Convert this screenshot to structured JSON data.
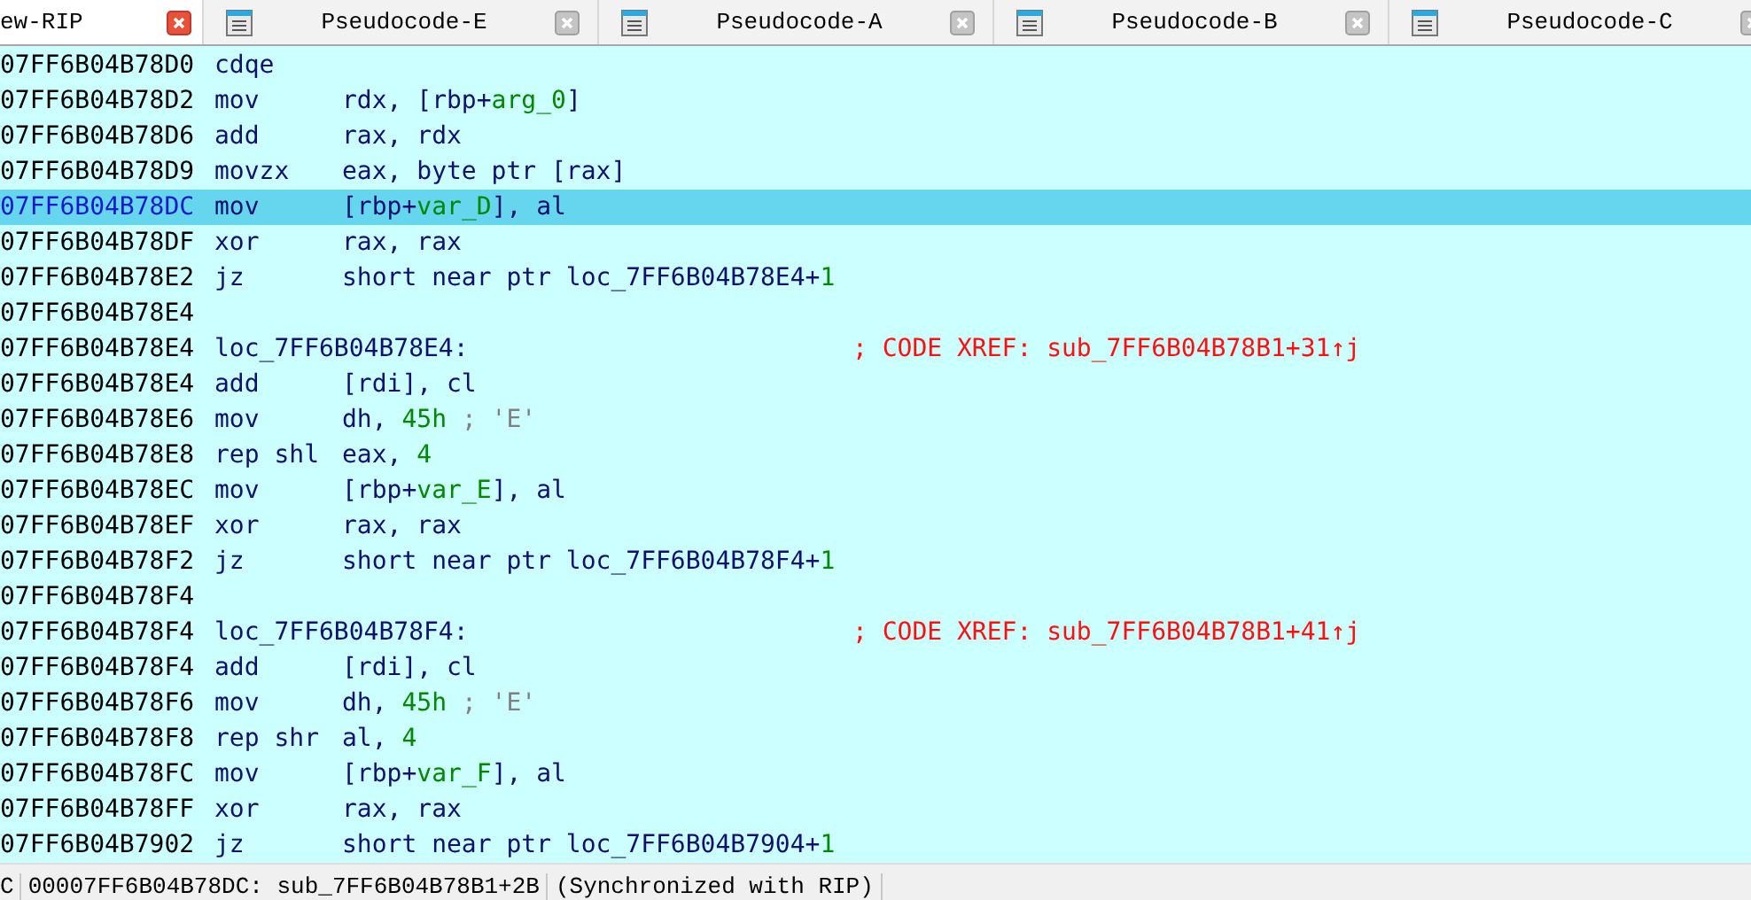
{
  "tabs": [
    {
      "label": "ew-RIP",
      "selected": true
    },
    {
      "label": "Pseudocode-E",
      "selected": false
    },
    {
      "label": "Pseudocode-A",
      "selected": false
    },
    {
      "label": "Pseudocode-B",
      "selected": false
    },
    {
      "label": "Pseudocode-C",
      "selected": false
    }
  ],
  "lines": [
    {
      "kind": "insn",
      "address": "07FF6B04B78D0",
      "mnemonic": "cdqe",
      "selected": false
    },
    {
      "kind": "insn",
      "address": "07FF6B04B78D2",
      "mnemonic": "mov",
      "operands": [
        {
          "text": "rdx, [rbp+",
          "kind": "plain"
        },
        {
          "text": "arg_0",
          "kind": "name"
        },
        {
          "text": "]",
          "kind": "plain"
        }
      ],
      "selected": false
    },
    {
      "kind": "insn",
      "address": "07FF6B04B78D6",
      "mnemonic": "add",
      "operands": [
        {
          "text": "rax, rdx",
          "kind": "plain"
        }
      ],
      "selected": false
    },
    {
      "kind": "insn",
      "address": "07FF6B04B78D9",
      "mnemonic": "movzx",
      "operands": [
        {
          "text": "eax, byte ptr [rax]",
          "kind": "plain"
        }
      ],
      "selected": false
    },
    {
      "kind": "insn",
      "address": "07FF6B04B78DC",
      "mnemonic": "mov",
      "operands": [
        {
          "text": "[rbp+",
          "kind": "plain"
        },
        {
          "text": "var_D",
          "kind": "name"
        },
        {
          "text": "], al",
          "kind": "plain"
        }
      ],
      "selected": true
    },
    {
      "kind": "insn",
      "address": "07FF6B04B78DF",
      "mnemonic": "xor",
      "operands": [
        {
          "text": "rax, rax",
          "kind": "plain"
        }
      ],
      "selected": false
    },
    {
      "kind": "insn",
      "address": "07FF6B04B78E2",
      "mnemonic": "jz",
      "operands": [
        {
          "text": "short near ptr loc_7FF6B04B78E4+",
          "kind": "plain"
        },
        {
          "text": "1",
          "kind": "num"
        }
      ],
      "selected": false
    },
    {
      "kind": "blank",
      "address": "07FF6B04B78E4",
      "selected": false
    },
    {
      "kind": "label",
      "address": "07FF6B04B78E4",
      "label": "loc_7FF6B04B78E4:",
      "xref": "; CODE XREF: sub_7FF6B04B78B1+31↑j",
      "selected": false
    },
    {
      "kind": "insn",
      "address": "07FF6B04B78E4",
      "mnemonic": "add",
      "operands": [
        {
          "text": "[rdi], cl",
          "kind": "plain"
        }
      ],
      "selected": false
    },
    {
      "kind": "insn",
      "address": "07FF6B04B78E6",
      "mnemonic": "mov",
      "operands": [
        {
          "text": "dh, ",
          "kind": "plain"
        },
        {
          "text": "45h",
          "kind": "num"
        },
        {
          "text": " ; 'E'",
          "kind": "comment"
        }
      ],
      "selected": false
    },
    {
      "kind": "insn",
      "address": "07FF6B04B78E8",
      "mnemonic": "rep shl",
      "operands": [
        {
          "text": "eax, ",
          "kind": "plain"
        },
        {
          "text": "4",
          "kind": "num"
        }
      ],
      "selected": false
    },
    {
      "kind": "insn",
      "address": "07FF6B04B78EC",
      "mnemonic": "mov",
      "operands": [
        {
          "text": "[rbp+",
          "kind": "plain"
        },
        {
          "text": "var_E",
          "kind": "name"
        },
        {
          "text": "], al",
          "kind": "plain"
        }
      ],
      "selected": false
    },
    {
      "kind": "insn",
      "address": "07FF6B04B78EF",
      "mnemonic": "xor",
      "operands": [
        {
          "text": "rax, rax",
          "kind": "plain"
        }
      ],
      "selected": false
    },
    {
      "kind": "insn",
      "address": "07FF6B04B78F2",
      "mnemonic": "jz",
      "operands": [
        {
          "text": "short near ptr loc_7FF6B04B78F4+",
          "kind": "plain"
        },
        {
          "text": "1",
          "kind": "num"
        }
      ],
      "selected": false
    },
    {
      "kind": "blank",
      "address": "07FF6B04B78F4",
      "selected": false
    },
    {
      "kind": "label",
      "address": "07FF6B04B78F4",
      "label": "loc_7FF6B04B78F4:",
      "xref": "; CODE XREF: sub_7FF6B04B78B1+41↑j",
      "selected": false
    },
    {
      "kind": "insn",
      "address": "07FF6B04B78F4",
      "mnemonic": "add",
      "operands": [
        {
          "text": "[rdi], cl",
          "kind": "plain"
        }
      ],
      "selected": false
    },
    {
      "kind": "insn",
      "address": "07FF6B04B78F6",
      "mnemonic": "mov",
      "operands": [
        {
          "text": "dh, ",
          "kind": "plain"
        },
        {
          "text": "45h",
          "kind": "num"
        },
        {
          "text": " ; 'E'",
          "kind": "comment"
        }
      ],
      "selected": false
    },
    {
      "kind": "insn",
      "address": "07FF6B04B78F8",
      "mnemonic": "rep shr",
      "operands": [
        {
          "text": "al, ",
          "kind": "plain"
        },
        {
          "text": "4",
          "kind": "num"
        }
      ],
      "selected": false
    },
    {
      "kind": "insn",
      "address": "07FF6B04B78FC",
      "mnemonic": "mov",
      "operands": [
        {
          "text": "[rbp+",
          "kind": "plain"
        },
        {
          "text": "var_F",
          "kind": "name"
        },
        {
          "text": "], al",
          "kind": "plain"
        }
      ],
      "selected": false
    },
    {
      "kind": "insn",
      "address": "07FF6B04B78FF",
      "mnemonic": "xor",
      "operands": [
        {
          "text": "rax, rax",
          "kind": "plain"
        }
      ],
      "selected": false
    },
    {
      "kind": "insn",
      "address": "07FF6B04B7902",
      "mnemonic": "jz",
      "operands": [
        {
          "text": "short near ptr loc_7FF6B04B7904+",
          "kind": "plain"
        },
        {
          "text": "1",
          "kind": "num"
        }
      ],
      "selected": false
    }
  ],
  "status_bar": {
    "prefix": "C",
    "location": "00007FF6B04B78DC: sub_7FF6B04B78B1+2B",
    "sync": "(Synchronized with RIP)"
  }
}
